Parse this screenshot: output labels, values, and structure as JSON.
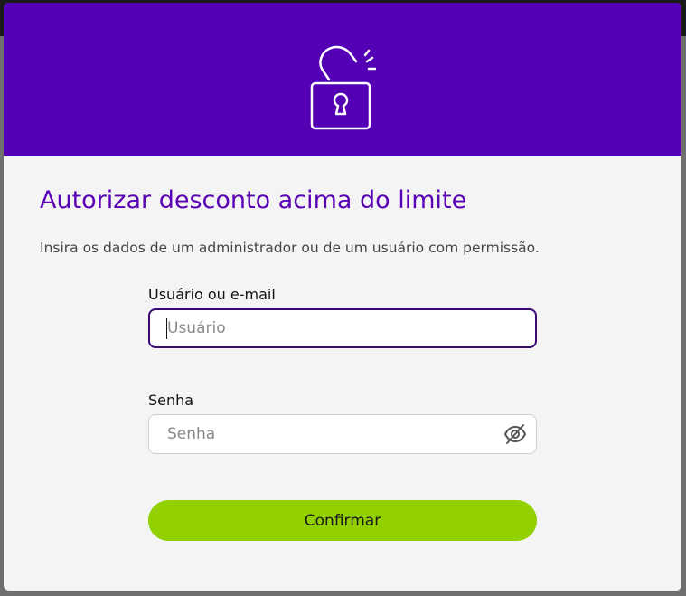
{
  "colors": {
    "header_bg": "#5400b4",
    "title": "#5a02b5",
    "modal_bg": "#f4f4f4",
    "button_bg": "#93d000",
    "focused_input_border": "#3a0a73"
  },
  "header": {
    "icon": "unlocked-padlock-icon"
  },
  "dialog": {
    "title": "Autorizar desconto acima do limite",
    "subtitle": "Insira os dados de um administrador ou de um usuário com permissão."
  },
  "form": {
    "username": {
      "label": "Usuário ou e-mail",
      "placeholder": "Usuário",
      "value": ""
    },
    "password": {
      "label": "Senha",
      "placeholder": "Senha",
      "value": "",
      "toggle_icon": "eye-off-icon"
    },
    "confirm_label": "Confirmar"
  }
}
